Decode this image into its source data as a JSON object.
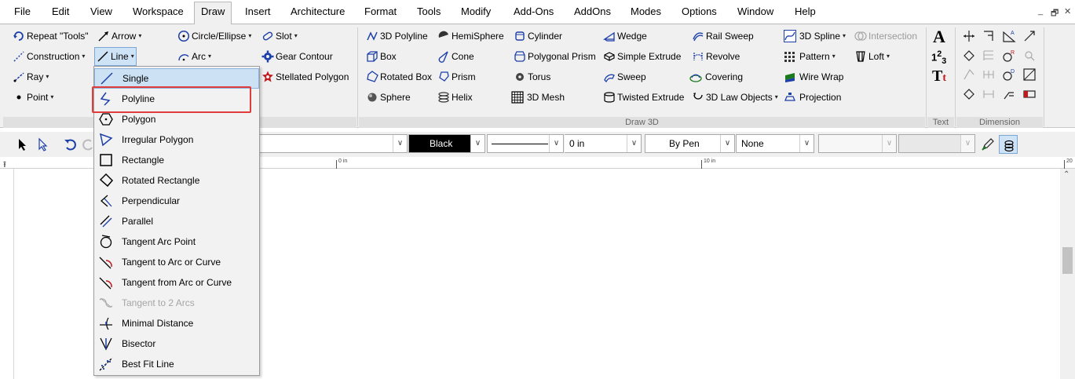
{
  "menubar": {
    "items": [
      "File",
      "Edit",
      "View",
      "Workspace",
      "Draw",
      "Insert",
      "Architecture",
      "Format",
      "Tools",
      "Modify",
      "Add-Ons",
      "AddOns",
      "Modes",
      "Options",
      "Window",
      "Help"
    ],
    "active": "Draw"
  },
  "window_controls": [
    "_",
    "🗗",
    "✕"
  ],
  "ribbon": {
    "col1": [
      "Repeat \"Tools\"",
      "Construction",
      "Ray",
      "Point"
    ],
    "col2": [
      "Arrow",
      "Line"
    ],
    "col3": [
      "Circle/Ellipse",
      "Arc"
    ],
    "col4": [
      "Slot",
      "Gear Contour",
      "Stellated Polygon"
    ],
    "draw3d_col1": [
      "3D Polyline",
      "Box",
      "Rotated Box",
      "Sphere"
    ],
    "draw3d_col2": [
      "HemiSphere",
      "Cone",
      "Prism",
      "Helix"
    ],
    "draw3d_col3": [
      "Cylinder",
      "Polygonal Prism",
      "Torus",
      "3D Mesh"
    ],
    "draw3d_col4": [
      "Wedge",
      "Simple Extrude",
      "Sweep",
      "Twisted Extrude"
    ],
    "draw3d_col5": [
      "Rail Sweep",
      "Revolve",
      "Covering",
      "3D Law Objects"
    ],
    "draw3d_col6": [
      "3D Spline",
      "Pattern",
      "Wire Wrap",
      "Projection"
    ],
    "draw3d_col7": [
      "Intersection",
      "Loft"
    ],
    "group_labels": {
      "draw3d": "Draw 3D",
      "text": "Text",
      "dimension": "Dimension"
    },
    "text_glyphs": [
      "A",
      "1",
      "2",
      "3",
      "T",
      "t"
    ]
  },
  "toolbar": {
    "color_value": "Black",
    "line_thickness": "0 in",
    "pen_value": "By Pen",
    "none_value": "None"
  },
  "ruler": {
    "label_0": "0 in",
    "label_10": "10 in",
    "label_20": "20"
  },
  "dropdown": {
    "items": [
      {
        "label": "Single",
        "icon": "line-single-icon",
        "disabled": false
      },
      {
        "label": "Polyline",
        "icon": "polyline-icon",
        "disabled": false
      },
      {
        "label": "Polygon",
        "icon": "polygon-icon",
        "disabled": false
      },
      {
        "label": "Irregular Polygon",
        "icon": "irregular-polygon-icon",
        "disabled": false
      },
      {
        "label": "Rectangle",
        "icon": "rectangle-icon",
        "disabled": false
      },
      {
        "label": "Rotated Rectangle",
        "icon": "rotated-rectangle-icon",
        "disabled": false
      },
      {
        "label": "Perpendicular",
        "icon": "perpendicular-icon",
        "disabled": false
      },
      {
        "label": "Parallel",
        "icon": "parallel-icon",
        "disabled": false
      },
      {
        "label": "Tangent Arc Point",
        "icon": "tangent-arc-point-icon",
        "disabled": false
      },
      {
        "label": "Tangent to Arc or Curve",
        "icon": "tangent-to-arc-icon",
        "disabled": false
      },
      {
        "label": "Tangent from Arc or Curve",
        "icon": "tangent-from-arc-icon",
        "disabled": false
      },
      {
        "label": "Tangent to 2 Arcs",
        "icon": "tangent-two-arcs-icon",
        "disabled": true
      },
      {
        "label": "Minimal Distance",
        "icon": "minimal-distance-icon",
        "disabled": false
      },
      {
        "label": "Bisector",
        "icon": "bisector-icon",
        "disabled": false
      },
      {
        "label": "Best Fit Line",
        "icon": "best-fit-line-icon",
        "disabled": false
      }
    ],
    "highlighted": "Polyline"
  },
  "colors": {
    "accent_blue": "#1c3fa8",
    "highlight_red": "#e03c3c",
    "ribbon_bg": "#f0f0f0",
    "color_swatch": "#000000"
  }
}
